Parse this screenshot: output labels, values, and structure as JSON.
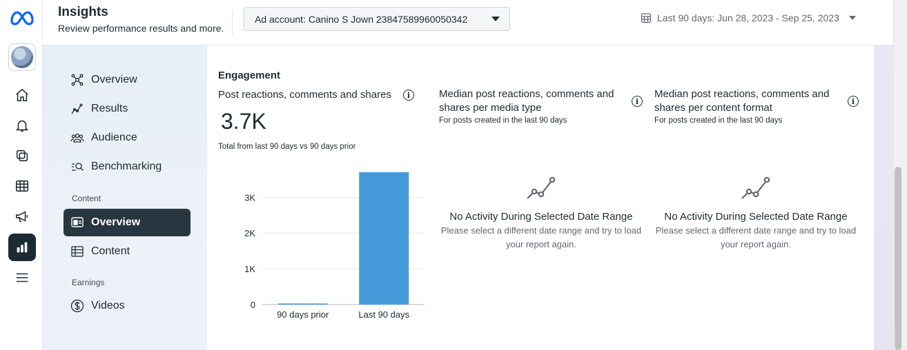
{
  "header": {
    "title": "Insights",
    "subtitle": "Review performance results and more.",
    "account_label": "Ad account: Canino S Jown 23847589960050342",
    "date_range": "Last 90 days: Jun 28, 2023 - Sep 25, 2023"
  },
  "rail": {
    "items": [
      "home-icon",
      "bell-icon",
      "pages-icon",
      "table-icon",
      "megaphone-icon",
      "bar-chart-icon",
      "menu-icon"
    ],
    "active": "bar-chart-icon"
  },
  "sidenav": {
    "top_items": [
      {
        "label": "Overview",
        "icon": "nodes-icon"
      },
      {
        "label": "Results",
        "icon": "trend-icon"
      },
      {
        "label": "Audience",
        "icon": "people-icon"
      },
      {
        "label": "Benchmarking",
        "icon": "benchmark-icon"
      }
    ],
    "content_section": "Content",
    "content_items": [
      {
        "label": "Overview",
        "icon": "cards-icon",
        "active": true
      },
      {
        "label": "Content",
        "icon": "grid-icon"
      }
    ],
    "earnings_section": "Earnings",
    "earnings_items": [
      {
        "label": "Videos",
        "icon": "dollar-icon"
      }
    ]
  },
  "engagement": {
    "title": "Engagement",
    "col1": {
      "title": "Post reactions, comments and shares",
      "value": "3.7K",
      "note": "Total from last 90 days vs 90 days prior"
    },
    "col2": {
      "title": "Median post reactions, comments and shares per media type",
      "note": "For posts created in the last 90 days",
      "empty_title": "No Activity During Selected Date Range",
      "empty_text": "Please select a different date range and try to load your report again."
    },
    "col3": {
      "title": "Median post reactions, comments and shares per content format",
      "note": "For posts created in the last 90 days",
      "empty_title": "No Activity During Selected Date Range",
      "empty_text": "Please select a different date range and try to load your report again."
    }
  },
  "chart_data": {
    "type": "bar",
    "categories": [
      "90 days prior",
      "Last 90 days"
    ],
    "values": [
      20,
      3700
    ],
    "yticks": [
      "0",
      "1K",
      "2K",
      "3K"
    ],
    "ytick_values": [
      0,
      1000,
      2000,
      3000
    ],
    "ylim": [
      0,
      3700
    ],
    "bar_color": "#4499d8",
    "grid": true
  },
  "colors": {
    "accent": "#4499d8",
    "active_nav": "#283640",
    "meta_blue": "#0866ff"
  }
}
